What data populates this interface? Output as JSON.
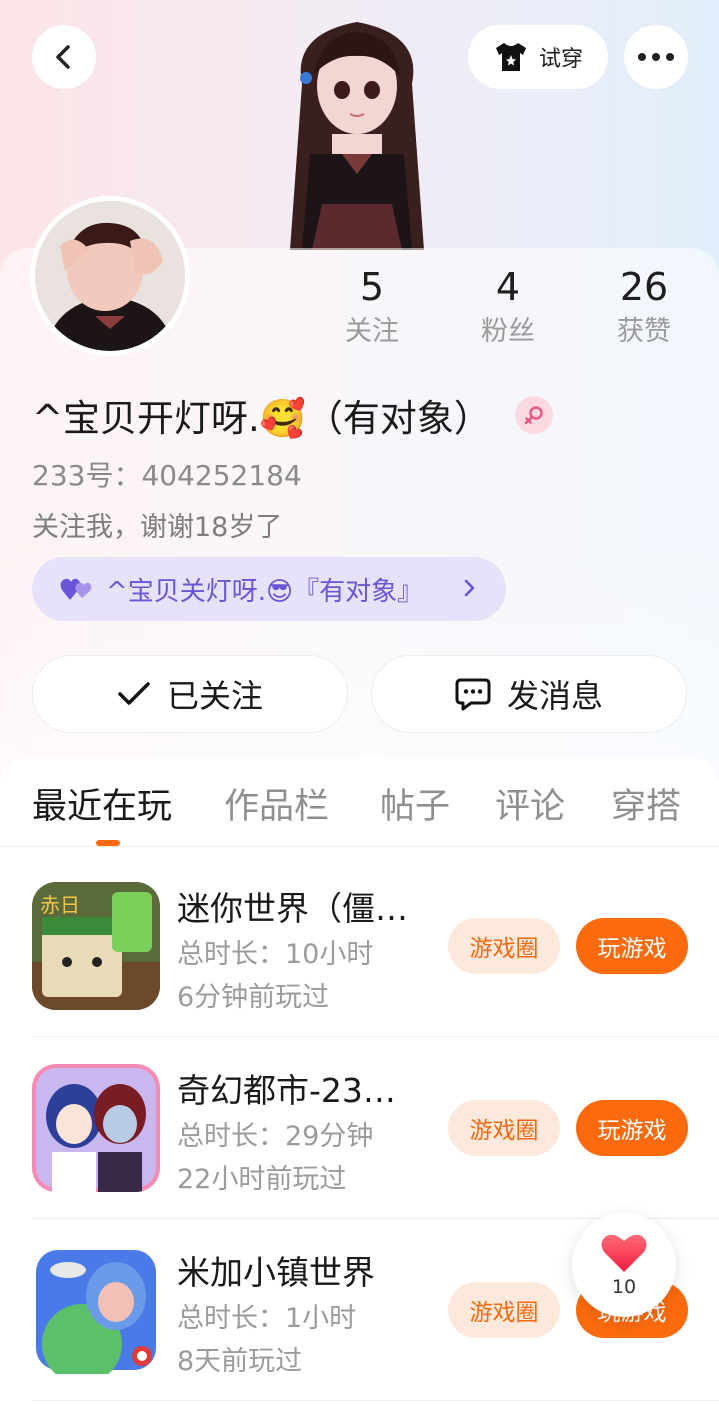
{
  "header": {
    "try_on_label": "试穿",
    "icons": [
      "chevron-left-icon",
      "tshirt-icon",
      "more-icon"
    ]
  },
  "profile": {
    "stats": [
      {
        "value": "5",
        "label": "关注"
      },
      {
        "value": "4",
        "label": "粉丝"
      },
      {
        "value": "26",
        "label": "获赞"
      }
    ],
    "nickname": "^宝贝开灯呀.🥰（有对象）",
    "id_line": "233号：404252184",
    "bio": "关注我，谢谢18岁了",
    "couple_tag": "^宝贝关灯呀.😎『有对象』"
  },
  "actions": {
    "follow_label": "已关注",
    "message_label": "发消息"
  },
  "tabs": [
    {
      "label": "最近在玩",
      "active": true
    },
    {
      "label": "作品栏",
      "active": false
    },
    {
      "label": "帖子",
      "active": false
    },
    {
      "label": "评论",
      "active": false
    },
    {
      "label": "穿搭",
      "active": false
    }
  ],
  "games": [
    {
      "title": "迷你世界（僵…",
      "duration": "总时长：10小时",
      "last_played": "6分钟前玩过",
      "circle_label": "游戏圈",
      "play_label": "玩游戏"
    },
    {
      "title": "奇幻都市-23…",
      "duration": "总时长：29分钟",
      "last_played": "22小时前玩过",
      "circle_label": "游戏圈",
      "play_label": "玩游戏"
    },
    {
      "title": "米加小镇世界",
      "duration": "总时长：1小时",
      "last_played": "8天前玩过",
      "circle_label": "游戏圈",
      "play_label": "玩游戏"
    }
  ],
  "like_float": {
    "count": "10"
  },
  "colors": {
    "accent": "#fb6a0e",
    "accent_light": "#fde8dc",
    "couple_bg": "#e7e1fa",
    "couple_text": "#6b55d6"
  }
}
